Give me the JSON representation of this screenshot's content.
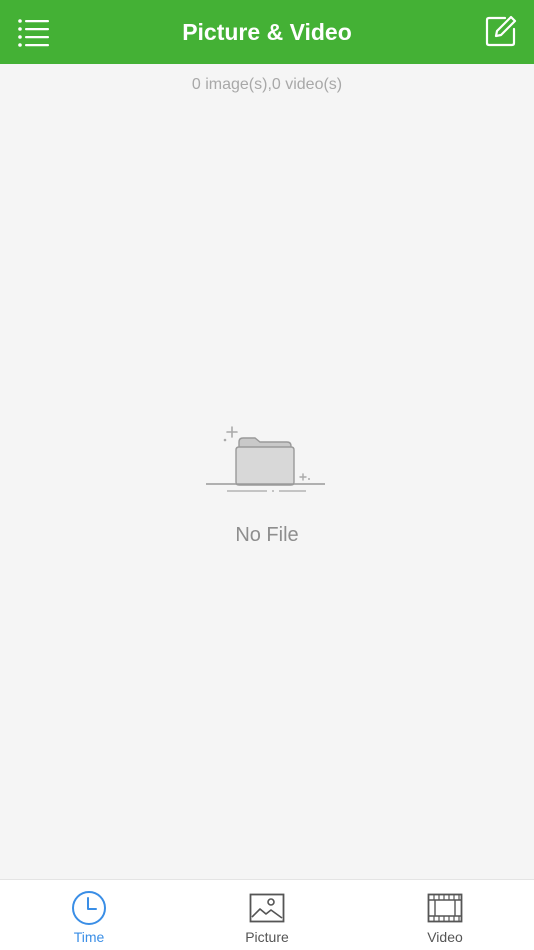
{
  "header": {
    "title": "Picture & Video",
    "menu_icon": "menu-icon",
    "edit_icon": "edit-icon"
  },
  "summary": {
    "text": "0 image(s),0 video(s)"
  },
  "empty_state": {
    "icon": "empty-folder-icon",
    "text": "No File"
  },
  "tabs": [
    {
      "label": "Time",
      "icon": "clock-icon",
      "active": true
    },
    {
      "label": "Picture",
      "icon": "image-icon",
      "active": false
    },
    {
      "label": "Video",
      "icon": "film-icon",
      "active": false
    }
  ],
  "colors": {
    "header_bg": "#44b135",
    "active_tab": "#3a8ee6",
    "background": "#f5f5f5"
  }
}
